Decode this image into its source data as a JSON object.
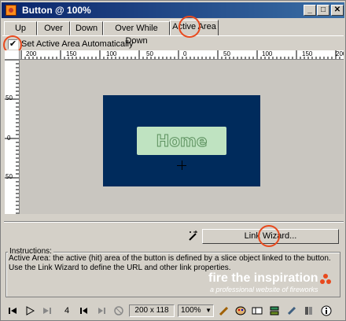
{
  "window": {
    "title": "Button @ 100%"
  },
  "title_buttons": {
    "minimize": "_",
    "maximize": "□",
    "close": "✕"
  },
  "tabs": [
    "Up",
    "Over",
    "Down",
    "Over While Down",
    "Active Area"
  ],
  "active_tab": "Active Area",
  "checkbox": {
    "label": "Set Active Area Automatically",
    "checked": true,
    "mark": "✔"
  },
  "ruler_top_labels": [
    "200",
    "150",
    "100",
    "50",
    "0",
    "50",
    "100",
    "150",
    "200"
  ],
  "ruler_left_labels": [
    "50",
    "0",
    "50"
  ],
  "canvas": {
    "button_text": "Home",
    "canvas_color": "#002b5c",
    "button_color": "#bfe3c1"
  },
  "link_wizard": {
    "label": "Link Wizard..."
  },
  "instructions": {
    "title": "Instructions:",
    "text": "Active Area: the active (hit) area of the button is defined by a slice object linked to the button. Use the Link Wizard to define the URL and other link properties."
  },
  "branding": {
    "main": "fire the inspiration",
    "sub": "a professional website of fireworks"
  },
  "statusbar": {
    "frame": "4",
    "size": "200 x 118",
    "zoom": "100%"
  },
  "accent_color": "#e8491d"
}
